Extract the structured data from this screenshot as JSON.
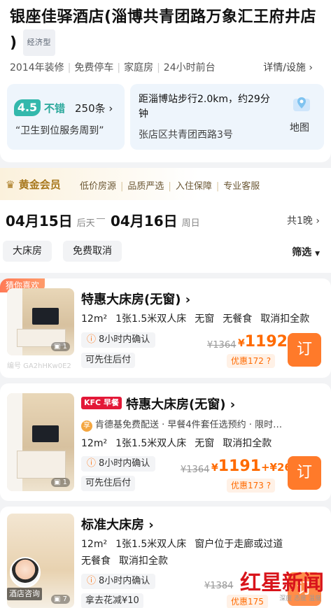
{
  "hotel": {
    "title": "银座佳驿酒店(淄博共青团路万象汇王府井店",
    "title_end": ")",
    "type_badge": "经济型",
    "facilities": [
      "2014年装修",
      "免费停车",
      "家庭房",
      "24小时前台"
    ],
    "detail_link": "详情/设施",
    "rating": {
      "score": "4.5",
      "word": "不错",
      "count": "250条",
      "quote": "“卫生到位服务周到”"
    },
    "location": {
      "distance": "距淄博站步行2.0km，约29分钟",
      "address": "张店区共青团西路3号",
      "map_label": "地图"
    }
  },
  "gold": {
    "title": "黄金会员",
    "items": [
      "低价房源",
      "品质严选",
      "入住保障",
      "专业客服"
    ]
  },
  "dates": {
    "checkin": "04月15日",
    "checkin_day": "后天",
    "checkout": "04月16日",
    "checkout_day": "周日",
    "nights": "共1晚",
    "chips": [
      "大床房",
      "免费取消"
    ],
    "filter": "筛选"
  },
  "rooms": [
    {
      "badge": "猜你喜欢",
      "name": "特惠大床房(无窗)",
      "specs": [
        "12m²",
        "1张1.5米双人床",
        "无窗",
        "无餐食",
        "取消扣全款"
      ],
      "confirm": "8小时内确认",
      "pay": "可先住后付",
      "old_price": "¥1364",
      "price": "1192",
      "discount": "优惠172",
      "photo_count": "1",
      "watermark": "编号 GA2hHKw0E2",
      "book": "订"
    },
    {
      "kfc": "KFC 早餐",
      "name": "特惠大床房(无窗)",
      "kfc_line": "肯德基免费配送 · 早餐4件套任选预约 · 限时…",
      "specs": [
        "12m²",
        "1张1.5米双人床",
        "无窗",
        "取消扣全款"
      ],
      "confirm": "8小时内确认",
      "pay": "可先住后付",
      "old_price": "¥1364",
      "price": "1191",
      "price_extra": "+¥26",
      "discount": "优惠173",
      "photo_count": "1",
      "book": "订"
    },
    {
      "name": "标准大床房",
      "specs": [
        "12m²",
        "1张1.5米双人床",
        "窗户位于走廊或过道"
      ],
      "specs2": [
        "无餐食",
        "取消扣全款"
      ],
      "confirm": "8小时内确认",
      "pay": "拿去花减¥10",
      "old_price": "¥1384",
      "discount": "优惠175",
      "consult": "酒店咨询",
      "photo_count": "7",
      "book": "订"
    }
  ],
  "logo": {
    "text": "红星新闻",
    "sub": "深度 态度 温度"
  }
}
